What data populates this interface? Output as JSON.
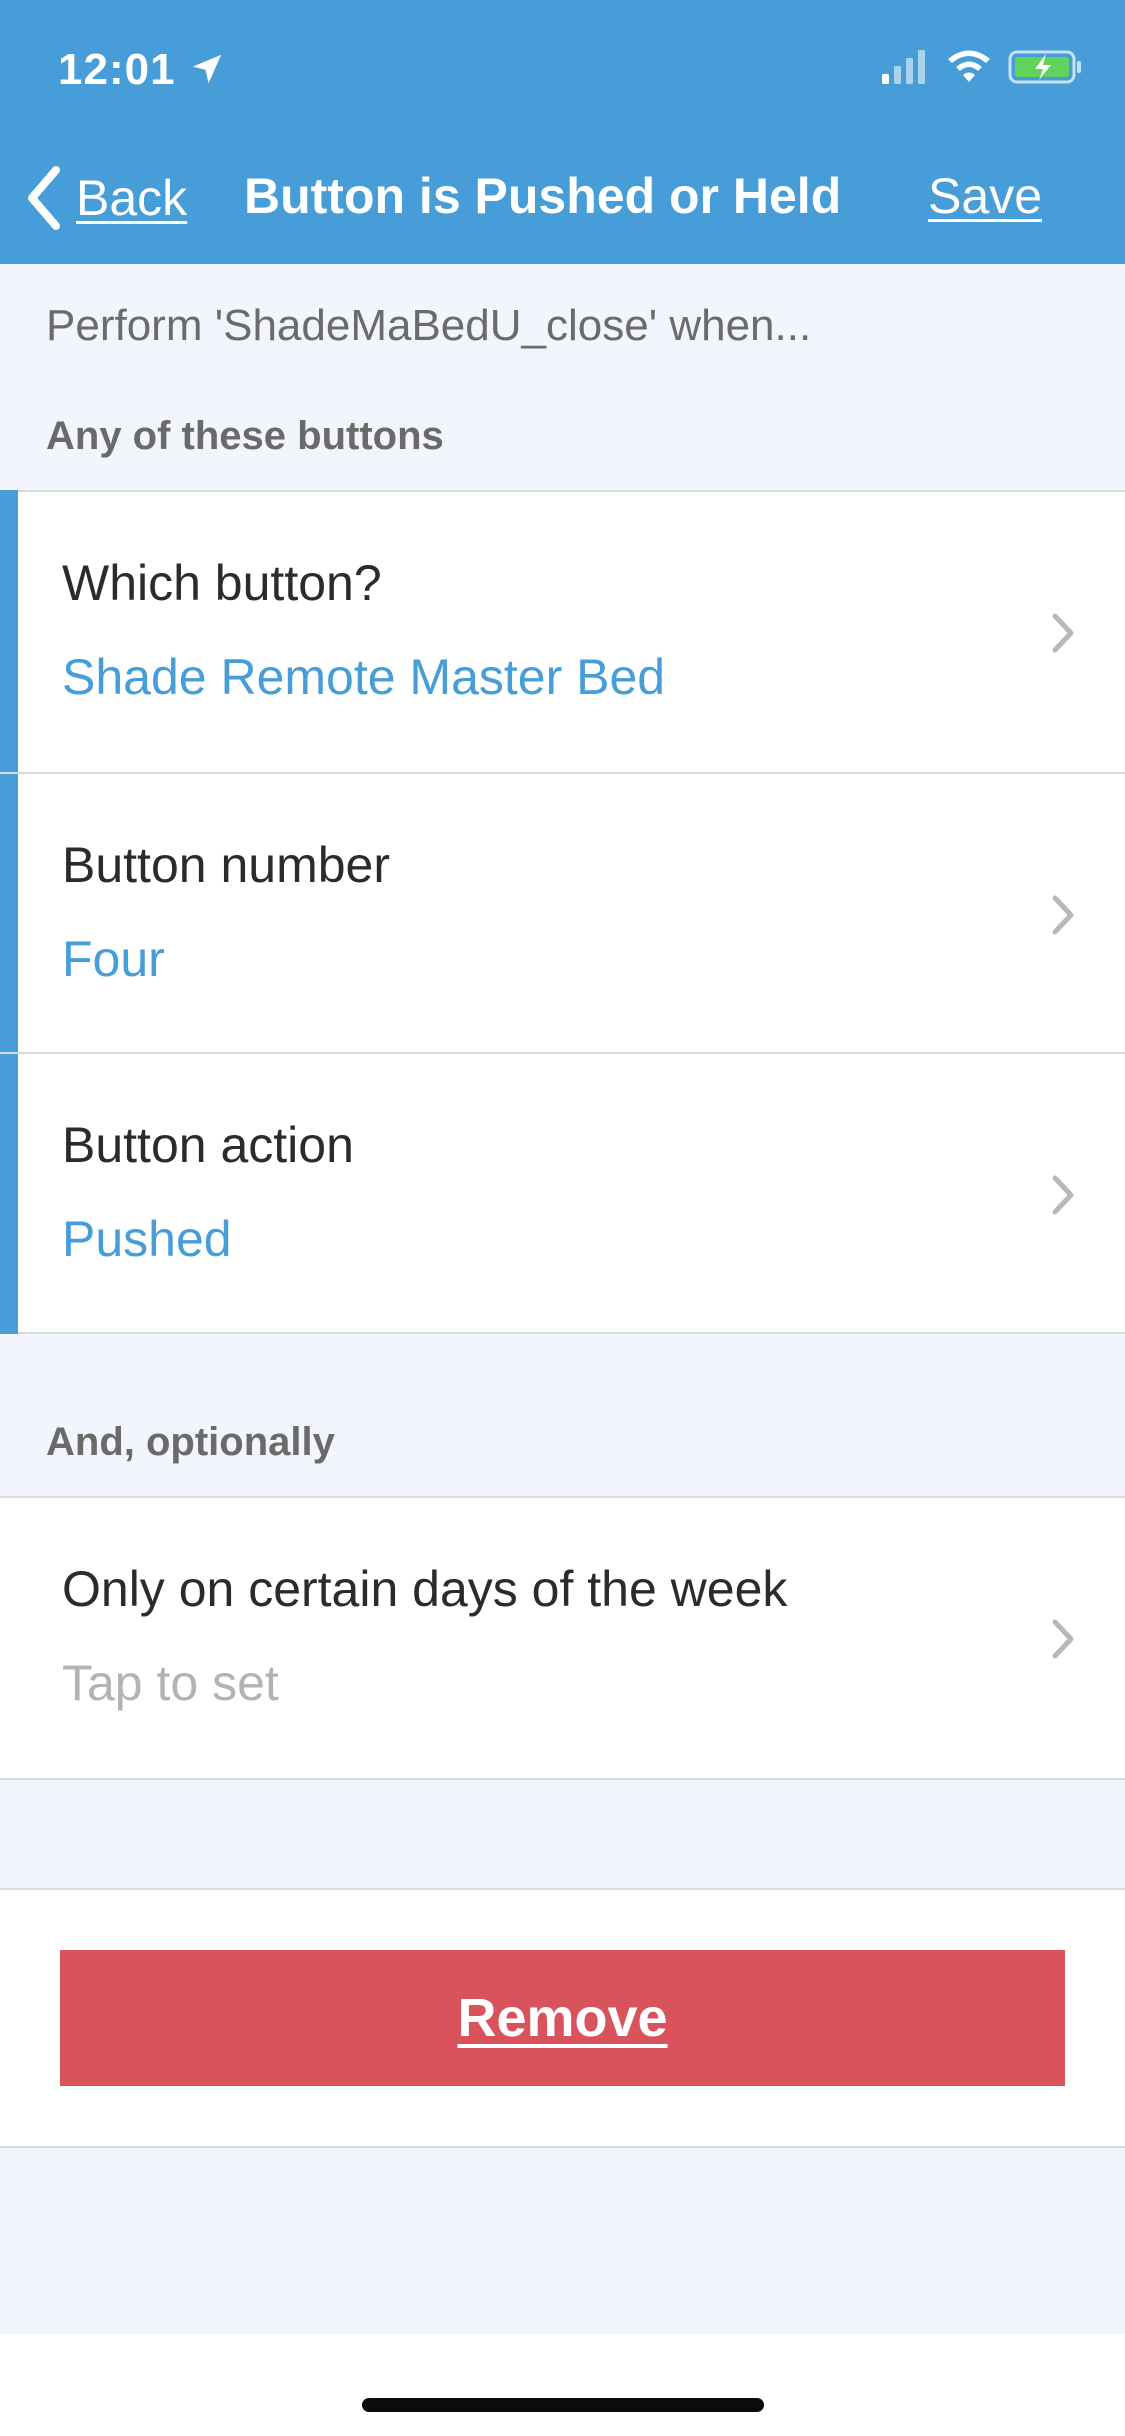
{
  "status_bar": {
    "time": "12:01",
    "icons": [
      "location-icon",
      "signal-icon",
      "wifi-icon",
      "battery-charging-icon"
    ]
  },
  "nav": {
    "back_label": "Back",
    "title": "Button is Pushed or Held",
    "save_label": "Save"
  },
  "description": "Perform 'ShadeMaBedU_close' when...",
  "sections": {
    "buttons_header": "Any of these buttons",
    "optional_header": "And, optionally"
  },
  "button_rows": [
    {
      "label": "Which button?",
      "value": "Shade Remote Master Bed"
    },
    {
      "label": "Button number",
      "value": "Four"
    },
    {
      "label": "Button action",
      "value": "Pushed"
    }
  ],
  "optional_rows": [
    {
      "label": "Only on certain days of the week",
      "value": "Tap to set"
    }
  ],
  "remove_label": "Remove",
  "colors": {
    "accent": "#469dd7",
    "danger": "#d9535d",
    "background": "#f2f6fc",
    "placeholder": "#b3b3b3"
  }
}
